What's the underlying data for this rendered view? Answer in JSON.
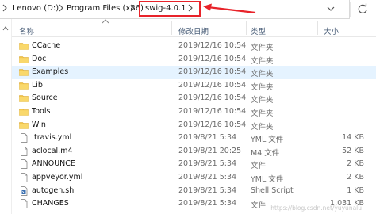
{
  "address_bar": {
    "crumbs": [
      "Lenovo (D:)",
      "Program Files (x86)"
    ],
    "current": "swig-4.0.1"
  },
  "columns": {
    "name": "名称",
    "date": "修改日期",
    "type": "类型",
    "size": "大小"
  },
  "files": [
    {
      "icon": "folder-icon",
      "name": "CCache",
      "date": "2019/12/16 10:54",
      "type": "文件夹",
      "size": ""
    },
    {
      "icon": "folder-icon",
      "name": "Doc",
      "date": "2019/12/16 10:54",
      "type": "文件夹",
      "size": ""
    },
    {
      "icon": "folder-icon",
      "name": "Examples",
      "date": "2019/12/16 10:54",
      "type": "文件夹",
      "size": "",
      "selected": true
    },
    {
      "icon": "folder-icon",
      "name": "Lib",
      "date": "2019/12/16 10:54",
      "type": "文件夹",
      "size": ""
    },
    {
      "icon": "folder-icon",
      "name": "Source",
      "date": "2019/12/16 10:54",
      "type": "文件夹",
      "size": ""
    },
    {
      "icon": "folder-icon",
      "name": "Tools",
      "date": "2019/12/16 10:54",
      "type": "文件夹",
      "size": ""
    },
    {
      "icon": "folder-icon",
      "name": "Win",
      "date": "2019/12/16 10:54",
      "type": "文件夹",
      "size": ""
    },
    {
      "icon": "file-icon",
      "name": ".travis.yml",
      "date": "2019/8/21 5:34",
      "type": "YML 文件",
      "size": "14 KB"
    },
    {
      "icon": "file-icon",
      "name": "aclocal.m4",
      "date": "2019/8/21 20:25",
      "type": "M4 文件",
      "size": "52 KB"
    },
    {
      "icon": "file-icon",
      "name": "ANNOUNCE",
      "date": "2019/8/21 5:34",
      "type": "文件",
      "size": "2 KB"
    },
    {
      "icon": "file-icon",
      "name": "appveyor.yml",
      "date": "2019/8/21 5:34",
      "type": "YML 文件",
      "size": "2 KB"
    },
    {
      "icon": "script-icon",
      "name": "autogen.sh",
      "date": "2019/8/21 5:34",
      "type": "Shell Script",
      "size": "1 KB"
    },
    {
      "icon": "file-icon",
      "name": "CHANGES",
      "date": "2019/8/21 5:34",
      "type": "文件",
      "size": "1,031 KB"
    }
  ],
  "watermark": "https://blog.csdn.net/yuyunalu",
  "colors": {
    "annotation_red": "#e8232a",
    "selection": "#e5f3ff",
    "folder_yellow": "#f4c74a"
  }
}
